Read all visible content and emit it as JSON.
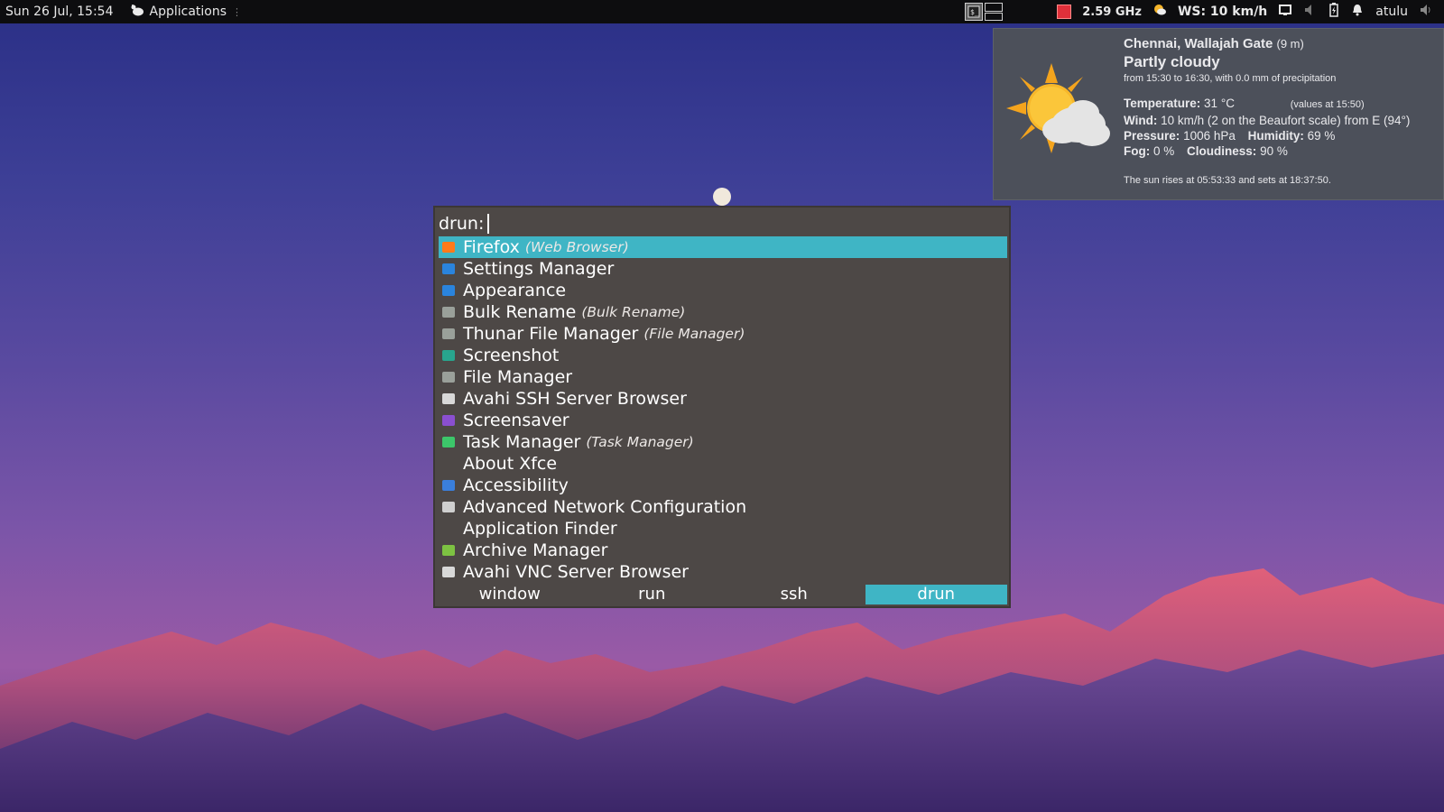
{
  "panel": {
    "datetime": "Sun 26 Jul, 15:54",
    "applications_label": "Applications",
    "cpu_freq": "2.59 GHz",
    "wind_label": "WS: 10 km/h",
    "username": "atulu"
  },
  "weather": {
    "location": "Chennai, Wallajah Gate",
    "altitude": "(9 m)",
    "condition": "Partly cloudy",
    "period": "from 15:30 to 16:30, with 0.0 mm of precipitation",
    "temperature_label": "Temperature:",
    "temperature_value": "31 °C",
    "values_at": "(values at 15:50)",
    "wind_label": "Wind:",
    "wind_value": "10 km/h (2 on the Beaufort scale) from E (94°)",
    "pressure_label": "Pressure:",
    "pressure_value": "1006 hPa",
    "humidity_label": "Humidity:",
    "humidity_value": "69 %",
    "fog_label": "Fog:",
    "fog_value": "0 %",
    "cloudiness_label": "Cloudiness:",
    "cloudiness_value": "90 %",
    "sun_text": "The sun rises at 05:53:33 and sets at 18:37:50."
  },
  "rofi": {
    "prompt": "drun:",
    "items": [
      {
        "label": "Firefox",
        "desc": "(Web Browser)",
        "icon": "firefox-icon",
        "color": "#ff7a1a"
      },
      {
        "label": "Settings Manager",
        "desc": "",
        "icon": "settings-manager-icon",
        "color": "#2a84dd"
      },
      {
        "label": "Appearance",
        "desc": "",
        "icon": "appearance-icon",
        "color": "#2a84dd"
      },
      {
        "label": "Bulk Rename",
        "desc": "(Bulk Rename)",
        "icon": "bulk-rename-icon",
        "color": "#9aa09a"
      },
      {
        "label": "Thunar File Manager",
        "desc": "(File Manager)",
        "icon": "thunar-icon",
        "color": "#9aa09a"
      },
      {
        "label": "Screenshot",
        "desc": "",
        "icon": "screenshot-icon",
        "color": "#28a58e"
      },
      {
        "label": "File Manager",
        "desc": "",
        "icon": "file-manager-icon",
        "color": "#9aa09a"
      },
      {
        "label": "Avahi SSH Server Browser",
        "desc": "",
        "icon": "avahi-ssh-icon",
        "color": "#d8d8d8"
      },
      {
        "label": "Screensaver",
        "desc": "",
        "icon": "screensaver-icon",
        "color": "#8a4fd0"
      },
      {
        "label": "Task Manager",
        "desc": "(Task Manager)",
        "icon": "task-manager-icon",
        "color": "#3cc66a"
      },
      {
        "label": "About Xfce",
        "desc": "",
        "icon": "about-xfce-icon",
        "color": "#4d4846"
      },
      {
        "label": "Accessibility",
        "desc": "",
        "icon": "accessibility-icon",
        "color": "#3a7fdc"
      },
      {
        "label": "Advanced Network Configuration",
        "desc": "",
        "icon": "network-config-icon",
        "color": "#cfcfcf"
      },
      {
        "label": "Application Finder",
        "desc": "",
        "icon": "application-finder-icon",
        "color": "#4d4846"
      },
      {
        "label": "Archive Manager",
        "desc": "",
        "icon": "archive-manager-icon",
        "color": "#7dc242"
      },
      {
        "label": "Avahi VNC Server Browser",
        "desc": "",
        "icon": "avahi-vnc-icon",
        "color": "#d8d8d8"
      }
    ],
    "modes": [
      "window",
      "run",
      "ssh",
      "drun"
    ],
    "active_mode": "drun",
    "selected_index": 0,
    "accent": "#3fb5c5"
  }
}
